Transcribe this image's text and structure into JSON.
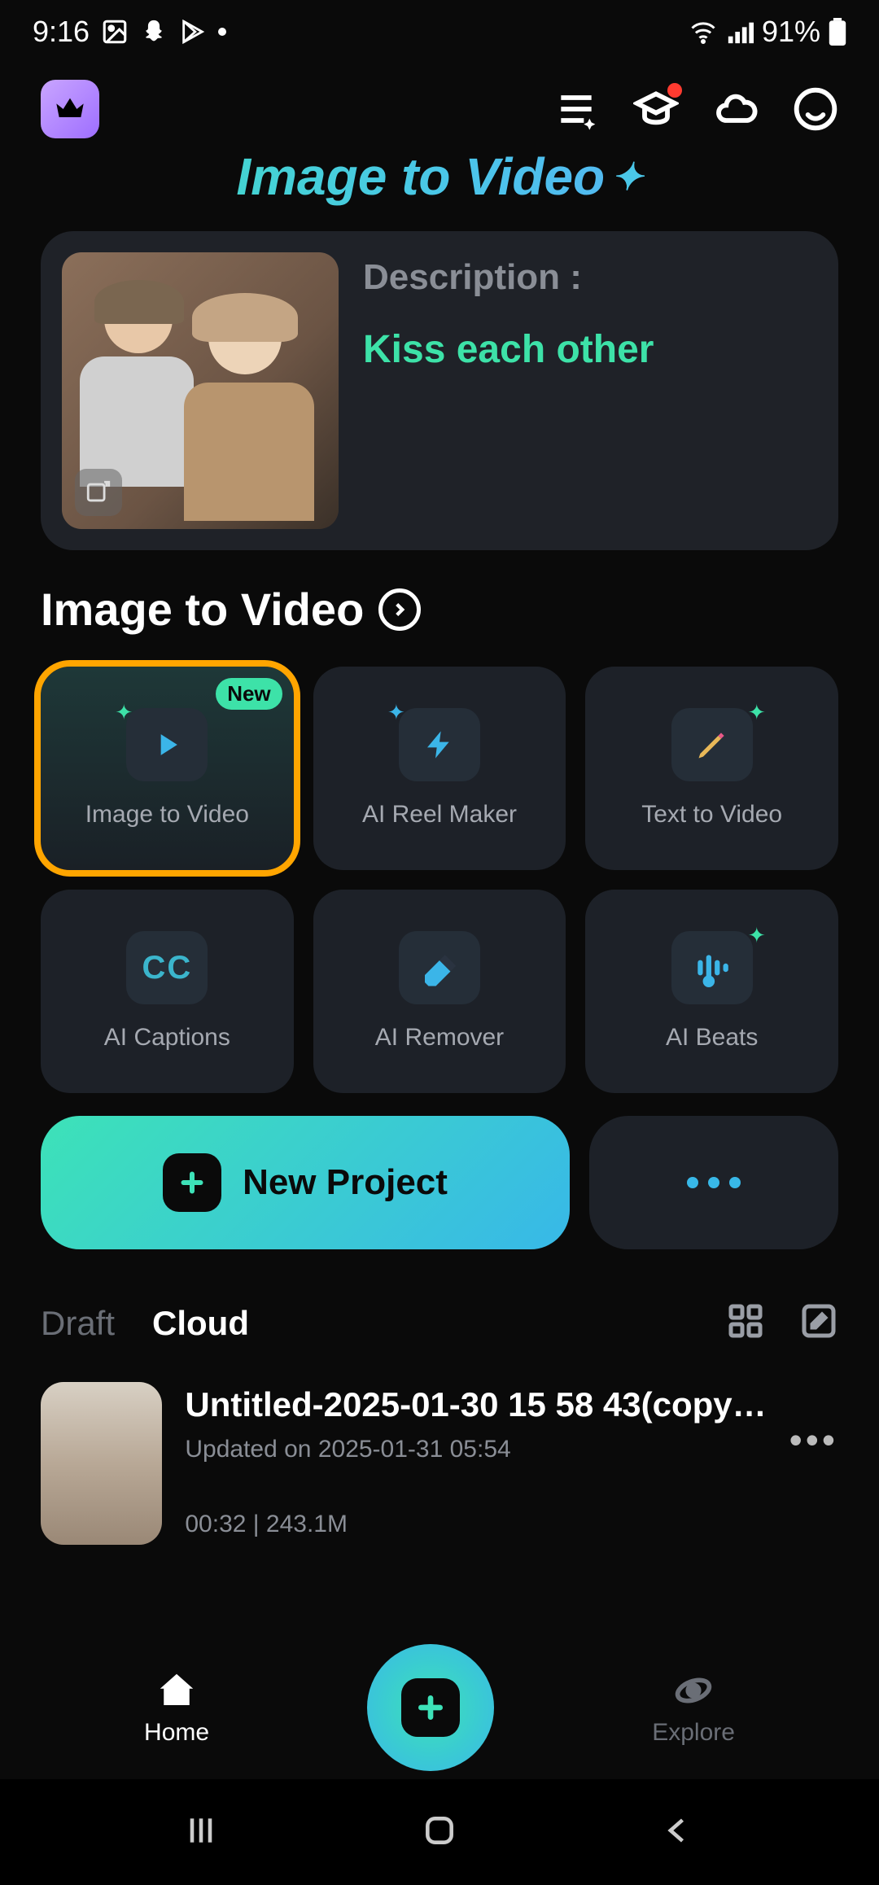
{
  "status": {
    "time": "9:16",
    "battery": "91%"
  },
  "hero": {
    "title": "Image to Video"
  },
  "promo": {
    "label": "Description :",
    "text": "Kiss each other"
  },
  "section": {
    "title": "Image to Video"
  },
  "tools": [
    {
      "label": "Image to Video",
      "badge": "New"
    },
    {
      "label": "AI Reel Maker"
    },
    {
      "label": "Text to Video"
    },
    {
      "label": "AI Captions"
    },
    {
      "label": "AI Remover"
    },
    {
      "label": "AI Beats"
    }
  ],
  "newProject": "New Project",
  "tabs": {
    "draft": "Draft",
    "cloud": "Cloud"
  },
  "project": {
    "title": "Untitled-2025-01-30 15 58 43(copy…",
    "updated": "Updated on 2025-01-31 05:54",
    "stats": "00:32  |  243.1M"
  },
  "nav": {
    "home": "Home",
    "explore": "Explore"
  }
}
